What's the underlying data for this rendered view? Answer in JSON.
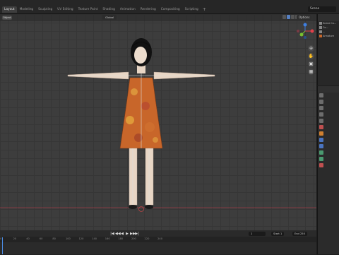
{
  "workspace_tabs": [
    "Layout",
    "Modeling",
    "Sculpting",
    "UV Editing",
    "Texture Paint",
    "Shading",
    "Animation",
    "Rendering",
    "Compositing",
    "Scripting"
  ],
  "workspace_add": "+",
  "scene_name": "Scene",
  "viewport": {
    "mode": "Object",
    "orientation": "Global",
    "options_label": "Options"
  },
  "outliner": {
    "rows": [
      "Scene Co...",
      "Co...",
      "...",
      "Armature"
    ]
  },
  "timeline": {
    "controls": [
      "|◀",
      "◀◀",
      "◀",
      "▶",
      "▶▶",
      "▶|"
    ],
    "current_frame": "1",
    "start_label": "Start",
    "start_value": "1",
    "end_label": "End",
    "end_value": "250",
    "ruler": [
      "0",
      "20",
      "40",
      "60",
      "80",
      "100",
      "120",
      "140",
      "160",
      "180",
      "200",
      "220",
      "240"
    ]
  },
  "colors": {
    "accent": "#4b8ce3",
    "axis_x": "#e0404a",
    "axis_y": "#78c030",
    "axis_z": "#3f7fe0",
    "dress_base": "#c8662a"
  }
}
